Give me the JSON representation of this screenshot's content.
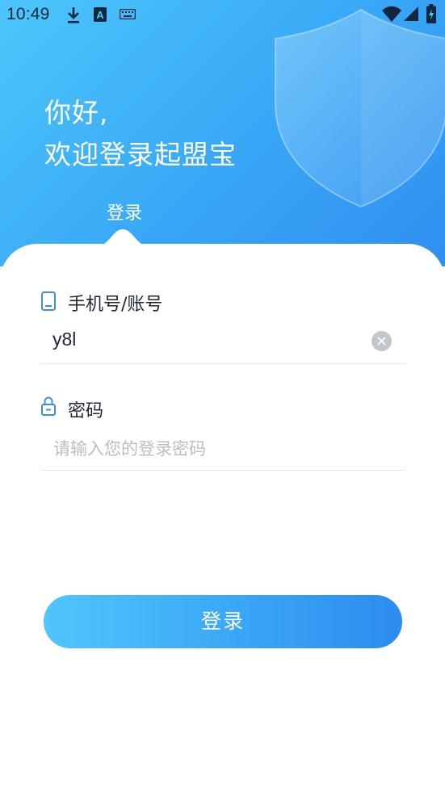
{
  "status_bar": {
    "time": "10:49",
    "icons": [
      "download-icon",
      "a-icon",
      "keyboard-icon",
      "wifi-icon",
      "signal-icon",
      "battery-icon"
    ]
  },
  "hero": {
    "greeting_line1": "你好,",
    "greeting_line2": "欢迎登录起盟宝",
    "tab_label": "登录",
    "decoration": "shield-icon"
  },
  "form": {
    "account_label": "手机号/账号",
    "account_value": "y8l",
    "password_label": "密码",
    "password_placeholder": "请输入您的登录密码"
  },
  "submit_label": "登录",
  "colors": {
    "gradient_start": "#4cc6fb",
    "gradient_end": "#2c8cef",
    "text_dark": "#1f2733",
    "placeholder": "#b9bec6"
  }
}
